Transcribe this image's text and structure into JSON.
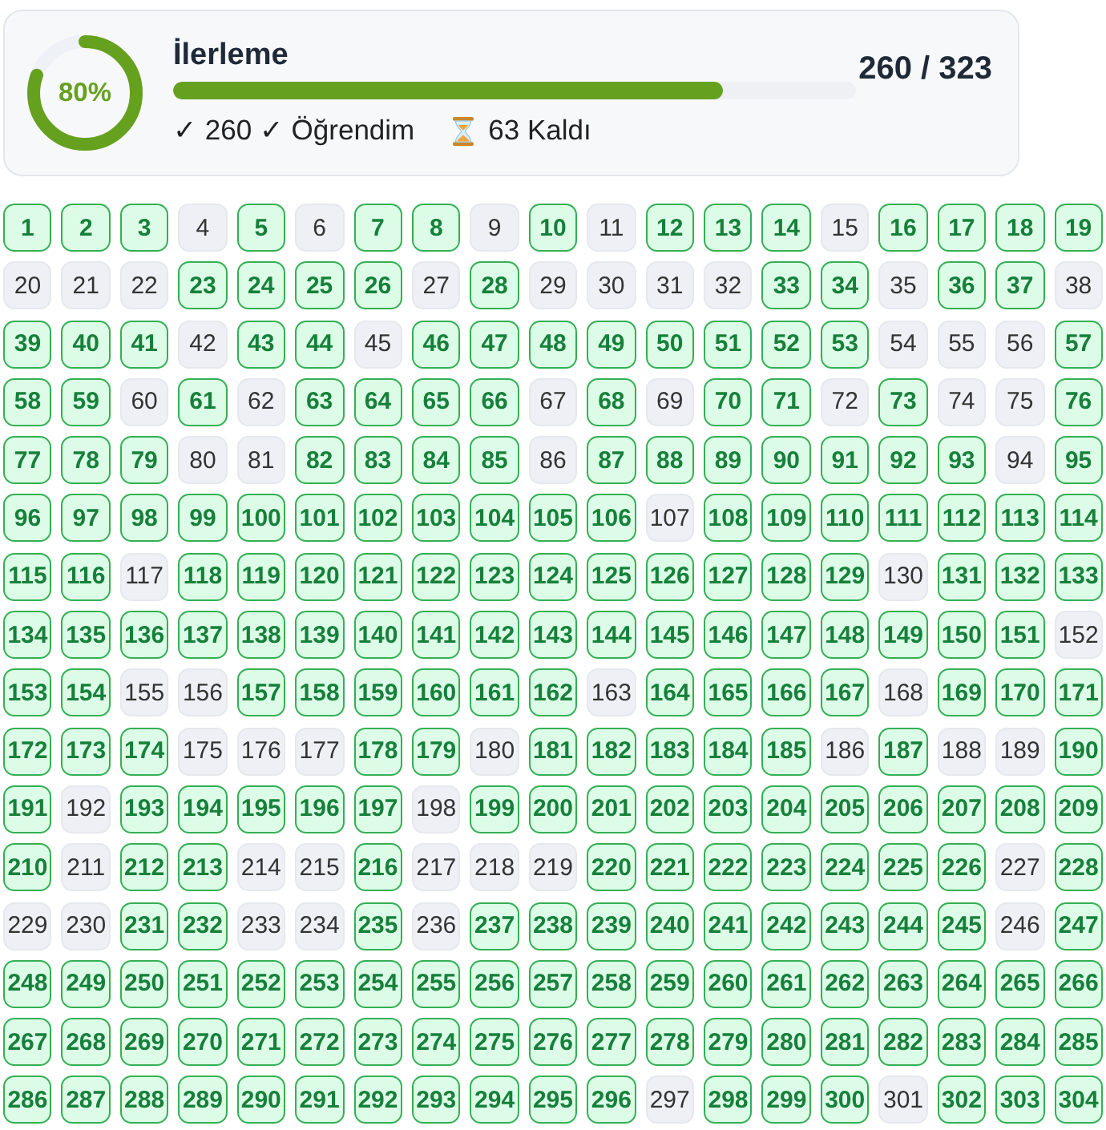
{
  "summary": {
    "ring": {
      "level": 0.805,
      "label": "80%"
    },
    "title": "İlerleme",
    "progress": {
      "level": 0.805
    },
    "count": "260 / 323",
    "learned": "✓ 260 ✓ Öğrendim",
    "remaining": "63 Kaldı"
  },
  "cells": [
    {
      "label": "1",
      "learned": true
    },
    {
      "label": "2",
      "learned": true
    },
    {
      "label": "3",
      "learned": true
    },
    {
      "label": "4",
      "learned": false
    },
    {
      "label": "5",
      "learned": true
    },
    {
      "label": "6",
      "learned": false
    },
    {
      "label": "7",
      "learned": true
    },
    {
      "label": "8",
      "learned": true
    },
    {
      "label": "9",
      "learned": false
    },
    {
      "label": "10",
      "learned": true
    },
    {
      "label": "11",
      "learned": false
    },
    {
      "label": "12",
      "learned": true
    },
    {
      "label": "13",
      "learned": true
    },
    {
      "label": "14",
      "learned": true
    },
    {
      "label": "15",
      "learned": false
    },
    {
      "label": "16",
      "learned": true
    },
    {
      "label": "17",
      "learned": true
    },
    {
      "label": "18",
      "learned": true
    },
    {
      "label": "19",
      "learned": true
    },
    {
      "label": "20",
      "learned": false
    },
    {
      "label": "21",
      "learned": false
    },
    {
      "label": "22",
      "learned": false
    },
    {
      "label": "23",
      "learned": true
    },
    {
      "label": "24",
      "learned": true
    },
    {
      "label": "25",
      "learned": true
    },
    {
      "label": "26",
      "learned": true
    },
    {
      "label": "27",
      "learned": false
    },
    {
      "label": "28",
      "learned": true
    },
    {
      "label": "29",
      "learned": false
    },
    {
      "label": "30",
      "learned": false
    },
    {
      "label": "31",
      "learned": false
    },
    {
      "label": "32",
      "learned": false
    },
    {
      "label": "33",
      "learned": true
    },
    {
      "label": "34",
      "learned": true
    },
    {
      "label": "35",
      "learned": false
    },
    {
      "label": "36",
      "learned": true
    },
    {
      "label": "37",
      "learned": true
    },
    {
      "label": "38",
      "learned": false
    },
    {
      "label": "39",
      "learned": true
    },
    {
      "label": "40",
      "learned": true
    },
    {
      "label": "41",
      "learned": true
    },
    {
      "label": "42",
      "learned": false
    },
    {
      "label": "43",
      "learned": true
    },
    {
      "label": "44",
      "learned": true
    },
    {
      "label": "45",
      "learned": false
    },
    {
      "label": "46",
      "learned": true
    },
    {
      "label": "47",
      "learned": true
    },
    {
      "label": "48",
      "learned": true
    },
    {
      "label": "49",
      "learned": true
    },
    {
      "label": "50",
      "learned": true
    },
    {
      "label": "51",
      "learned": true
    },
    {
      "label": "52",
      "learned": true
    },
    {
      "label": "53",
      "learned": true
    },
    {
      "label": "54",
      "learned": false
    },
    {
      "label": "55",
      "learned": false
    },
    {
      "label": "56",
      "learned": false
    },
    {
      "label": "57",
      "learned": true
    },
    {
      "label": "58",
      "learned": true
    },
    {
      "label": "59",
      "learned": true
    },
    {
      "label": "60",
      "learned": false
    },
    {
      "label": "61",
      "learned": true
    },
    {
      "label": "62",
      "learned": false
    },
    {
      "label": "63",
      "learned": true
    },
    {
      "label": "64",
      "learned": true
    },
    {
      "label": "65",
      "learned": true
    },
    {
      "label": "66",
      "learned": true
    },
    {
      "label": "67",
      "learned": false
    },
    {
      "label": "68",
      "learned": true
    },
    {
      "label": "69",
      "learned": false
    },
    {
      "label": "70",
      "learned": true
    },
    {
      "label": "71",
      "learned": true
    },
    {
      "label": "72",
      "learned": false
    },
    {
      "label": "73",
      "learned": true
    },
    {
      "label": "74",
      "learned": false
    },
    {
      "label": "75",
      "learned": false
    },
    {
      "label": "76",
      "learned": true
    },
    {
      "label": "77",
      "learned": true
    },
    {
      "label": "78",
      "learned": true
    },
    {
      "label": "79",
      "learned": true
    },
    {
      "label": "80",
      "learned": false
    },
    {
      "label": "81",
      "learned": false
    },
    {
      "label": "82",
      "learned": true
    },
    {
      "label": "83",
      "learned": true
    },
    {
      "label": "84",
      "learned": true
    },
    {
      "label": "85",
      "learned": true
    },
    {
      "label": "86",
      "learned": false
    },
    {
      "label": "87",
      "learned": true
    },
    {
      "label": "88",
      "learned": true
    },
    {
      "label": "89",
      "learned": true
    },
    {
      "label": "90",
      "learned": true
    },
    {
      "label": "91",
      "learned": true
    },
    {
      "label": "92",
      "learned": true
    },
    {
      "label": "93",
      "learned": true
    },
    {
      "label": "94",
      "learned": false
    },
    {
      "label": "95",
      "learned": true
    },
    {
      "label": "96",
      "learned": true
    },
    {
      "label": "97",
      "learned": true
    },
    {
      "label": "98",
      "learned": true
    },
    {
      "label": "99",
      "learned": true
    },
    {
      "label": "100",
      "learned": true
    },
    {
      "label": "101",
      "learned": true
    },
    {
      "label": "102",
      "learned": true
    },
    {
      "label": "103",
      "learned": true
    },
    {
      "label": "104",
      "learned": true
    },
    {
      "label": "105",
      "learned": true
    },
    {
      "label": "106",
      "learned": true
    },
    {
      "label": "107",
      "learned": false
    },
    {
      "label": "108",
      "learned": true
    },
    {
      "label": "109",
      "learned": true
    },
    {
      "label": "110",
      "learned": true
    },
    {
      "label": "111",
      "learned": true
    },
    {
      "label": "112",
      "learned": true
    },
    {
      "label": "113",
      "learned": true
    },
    {
      "label": "114",
      "learned": true
    },
    {
      "label": "115",
      "learned": true
    },
    {
      "label": "116",
      "learned": true
    },
    {
      "label": "117",
      "learned": false
    },
    {
      "label": "118",
      "learned": true
    },
    {
      "label": "119",
      "learned": true
    },
    {
      "label": "120",
      "learned": true
    },
    {
      "label": "121",
      "learned": true
    },
    {
      "label": "122",
      "learned": true
    },
    {
      "label": "123",
      "learned": true
    },
    {
      "label": "124",
      "learned": true
    },
    {
      "label": "125",
      "learned": true
    },
    {
      "label": "126",
      "learned": true
    },
    {
      "label": "127",
      "learned": true
    },
    {
      "label": "128",
      "learned": true
    },
    {
      "label": "129",
      "learned": true
    },
    {
      "label": "130",
      "learned": false
    },
    {
      "label": "131",
      "learned": true
    },
    {
      "label": "132",
      "learned": true
    },
    {
      "label": "133",
      "learned": true
    },
    {
      "label": "134",
      "learned": true
    },
    {
      "label": "135",
      "learned": true
    },
    {
      "label": "136",
      "learned": true
    },
    {
      "label": "137",
      "learned": true
    },
    {
      "label": "138",
      "learned": true
    },
    {
      "label": "139",
      "learned": true
    },
    {
      "label": "140",
      "learned": true
    },
    {
      "label": "141",
      "learned": true
    },
    {
      "label": "142",
      "learned": true
    },
    {
      "label": "143",
      "learned": true
    },
    {
      "label": "144",
      "learned": true
    },
    {
      "label": "145",
      "learned": true
    },
    {
      "label": "146",
      "learned": true
    },
    {
      "label": "147",
      "learned": true
    },
    {
      "label": "148",
      "learned": true
    },
    {
      "label": "149",
      "learned": true
    },
    {
      "label": "150",
      "learned": true
    },
    {
      "label": "151",
      "learned": true
    },
    {
      "label": "152",
      "learned": false
    },
    {
      "label": "153",
      "learned": true
    },
    {
      "label": "154",
      "learned": true
    },
    {
      "label": "155",
      "learned": false
    },
    {
      "label": "156",
      "learned": false
    },
    {
      "label": "157",
      "learned": true
    },
    {
      "label": "158",
      "learned": true
    },
    {
      "label": "159",
      "learned": true
    },
    {
      "label": "160",
      "learned": true
    },
    {
      "label": "161",
      "learned": true
    },
    {
      "label": "162",
      "learned": true
    },
    {
      "label": "163",
      "learned": false
    },
    {
      "label": "164",
      "learned": true
    },
    {
      "label": "165",
      "learned": true
    },
    {
      "label": "166",
      "learned": true
    },
    {
      "label": "167",
      "learned": true
    },
    {
      "label": "168",
      "learned": false
    },
    {
      "label": "169",
      "learned": true
    },
    {
      "label": "170",
      "learned": true
    },
    {
      "label": "171",
      "learned": true
    },
    {
      "label": "172",
      "learned": true
    },
    {
      "label": "173",
      "learned": true
    },
    {
      "label": "174",
      "learned": true
    },
    {
      "label": "175",
      "learned": false
    },
    {
      "label": "176",
      "learned": false
    },
    {
      "label": "177",
      "learned": false
    },
    {
      "label": "178",
      "learned": true
    },
    {
      "label": "179",
      "learned": true
    },
    {
      "label": "180",
      "learned": false
    },
    {
      "label": "181",
      "learned": true
    },
    {
      "label": "182",
      "learned": true
    },
    {
      "label": "183",
      "learned": true
    },
    {
      "label": "184",
      "learned": true
    },
    {
      "label": "185",
      "learned": true
    },
    {
      "label": "186",
      "learned": false
    },
    {
      "label": "187",
      "learned": true
    },
    {
      "label": "188",
      "learned": false
    },
    {
      "label": "189",
      "learned": false
    },
    {
      "label": "190",
      "learned": true
    },
    {
      "label": "191",
      "learned": true
    },
    {
      "label": "192",
      "learned": false
    },
    {
      "label": "193",
      "learned": true
    },
    {
      "label": "194",
      "learned": true
    },
    {
      "label": "195",
      "learned": true
    },
    {
      "label": "196",
      "learned": true
    },
    {
      "label": "197",
      "learned": true
    },
    {
      "label": "198",
      "learned": false
    },
    {
      "label": "199",
      "learned": true
    },
    {
      "label": "200",
      "learned": true
    },
    {
      "label": "201",
      "learned": true
    },
    {
      "label": "202",
      "learned": true
    },
    {
      "label": "203",
      "learned": true
    },
    {
      "label": "204",
      "learned": true
    },
    {
      "label": "205",
      "learned": true
    },
    {
      "label": "206",
      "learned": true
    },
    {
      "label": "207",
      "learned": true
    },
    {
      "label": "208",
      "learned": true
    },
    {
      "label": "209",
      "learned": true
    },
    {
      "label": "210",
      "learned": true
    },
    {
      "label": "211",
      "learned": false
    },
    {
      "label": "212",
      "learned": true
    },
    {
      "label": "213",
      "learned": true
    },
    {
      "label": "214",
      "learned": false
    },
    {
      "label": "215",
      "learned": false
    },
    {
      "label": "216",
      "learned": true
    },
    {
      "label": "217",
      "learned": false
    },
    {
      "label": "218",
      "learned": false
    },
    {
      "label": "219",
      "learned": false
    },
    {
      "label": "220",
      "learned": true
    },
    {
      "label": "221",
      "learned": true
    },
    {
      "label": "222",
      "learned": true
    },
    {
      "label": "223",
      "learned": true
    },
    {
      "label": "224",
      "learned": true
    },
    {
      "label": "225",
      "learned": true
    },
    {
      "label": "226",
      "learned": true
    },
    {
      "label": "227",
      "learned": false
    },
    {
      "label": "228",
      "learned": true
    },
    {
      "label": "229",
      "learned": false
    },
    {
      "label": "230",
      "learned": false
    },
    {
      "label": "231",
      "learned": true
    },
    {
      "label": "232",
      "learned": true
    },
    {
      "label": "233",
      "learned": false
    },
    {
      "label": "234",
      "learned": false
    },
    {
      "label": "235",
      "learned": true
    },
    {
      "label": "236",
      "learned": false
    },
    {
      "label": "237",
      "learned": true
    },
    {
      "label": "238",
      "learned": true
    },
    {
      "label": "239",
      "learned": true
    },
    {
      "label": "240",
      "learned": true
    },
    {
      "label": "241",
      "learned": true
    },
    {
      "label": "242",
      "learned": true
    },
    {
      "label": "243",
      "learned": true
    },
    {
      "label": "244",
      "learned": true
    },
    {
      "label": "245",
      "learned": true
    },
    {
      "label": "246",
      "learned": false
    },
    {
      "label": "247",
      "learned": true
    },
    {
      "label": "248",
      "learned": true
    },
    {
      "label": "249",
      "learned": true
    },
    {
      "label": "250",
      "learned": true
    },
    {
      "label": "251",
      "learned": true
    },
    {
      "label": "252",
      "learned": true
    },
    {
      "label": "253",
      "learned": true
    },
    {
      "label": "254",
      "learned": true
    },
    {
      "label": "255",
      "learned": true
    },
    {
      "label": "256",
      "learned": true
    },
    {
      "label": "257",
      "learned": true
    },
    {
      "label": "258",
      "learned": true
    },
    {
      "label": "259",
      "learned": true
    },
    {
      "label": "260",
      "learned": true
    },
    {
      "label": "261",
      "learned": true
    },
    {
      "label": "262",
      "learned": true
    },
    {
      "label": "263",
      "learned": true
    },
    {
      "label": "264",
      "learned": true
    },
    {
      "label": "265",
      "learned": true
    },
    {
      "label": "266",
      "learned": true
    },
    {
      "label": "267",
      "learned": true
    },
    {
      "label": "268",
      "learned": true
    },
    {
      "label": "269",
      "learned": true
    },
    {
      "label": "270",
      "learned": true
    },
    {
      "label": "271",
      "learned": true
    },
    {
      "label": "272",
      "learned": true
    },
    {
      "label": "273",
      "learned": true
    },
    {
      "label": "274",
      "learned": true
    },
    {
      "label": "275",
      "learned": true
    },
    {
      "label": "276",
      "learned": true
    },
    {
      "label": "277",
      "learned": true
    },
    {
      "label": "278",
      "learned": true
    },
    {
      "label": "279",
      "learned": true
    },
    {
      "label": "280",
      "learned": true
    },
    {
      "label": "281",
      "learned": true
    },
    {
      "label": "282",
      "learned": true
    },
    {
      "label": "283",
      "learned": true
    },
    {
      "label": "284",
      "learned": true
    },
    {
      "label": "285",
      "learned": true
    },
    {
      "label": "286",
      "learned": true
    },
    {
      "label": "287",
      "learned": true
    },
    {
      "label": "288",
      "learned": true
    },
    {
      "label": "289",
      "learned": true
    },
    {
      "label": "290",
      "learned": true
    },
    {
      "label": "291",
      "learned": true
    },
    {
      "label": "292",
      "learned": true
    },
    {
      "label": "293",
      "learned": true
    },
    {
      "label": "294",
      "learned": true
    },
    {
      "label": "295",
      "learned": true
    },
    {
      "label": "296",
      "learned": true
    },
    {
      "label": "297",
      "learned": false
    },
    {
      "label": "298",
      "learned": true
    },
    {
      "label": "299",
      "learned": true
    },
    {
      "label": "300",
      "learned": true
    },
    {
      "label": "301",
      "learned": false
    },
    {
      "label": "302",
      "learned": true
    },
    {
      "label": "303",
      "learned": true
    },
    {
      "label": "304",
      "learned": true
    }
  ]
}
